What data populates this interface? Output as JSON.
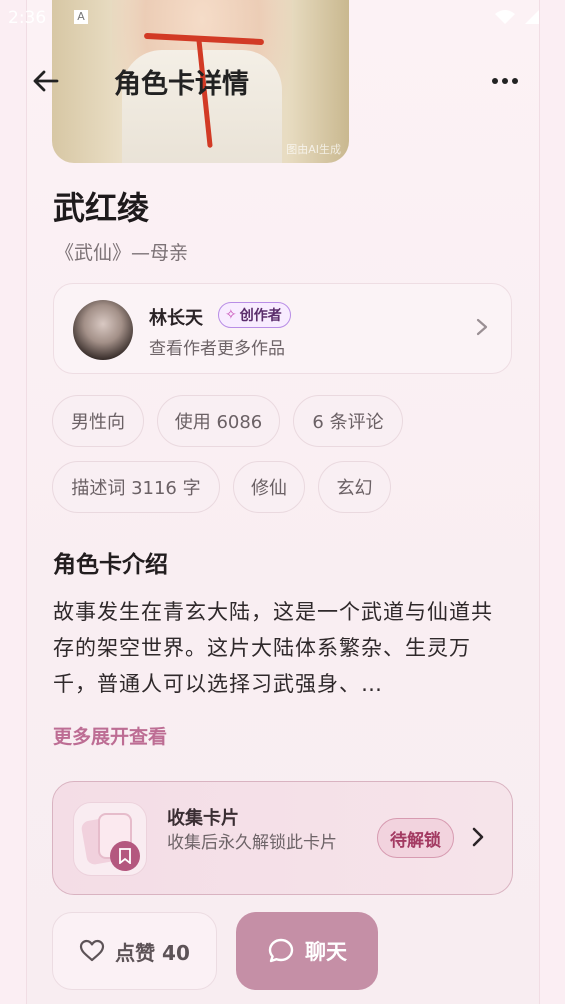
{
  "status_bar": {
    "time": "2:36",
    "notif_icon": "A"
  },
  "header": {
    "title": "角色卡详情",
    "back_icon": "arrow-left-icon",
    "more_icon": "more-dots-icon"
  },
  "hero": {
    "watermark": "图由AI生成"
  },
  "character": {
    "name": "武红绫",
    "subtitle": "《武仙》—母亲"
  },
  "author": {
    "name": "林长天",
    "badge": "创作者",
    "more_text": "查看作者更多作品"
  },
  "tags": [
    "男性向",
    "使用 6086",
    "6 条评论",
    "描述词 3116 字",
    "修仙",
    "玄幻"
  ],
  "intro": {
    "title": "角色卡介绍",
    "text": "故事发生在青玄大陆，这是一个武道与仙道共存的架空世界。这片大陆体系繁杂、生灵万千，普通人可以选择习武强身、…",
    "expand_label": "更多展开查看"
  },
  "collect": {
    "title": "收集卡片",
    "description": "收集后永久解锁此卡片",
    "status": "待解锁"
  },
  "actions": {
    "like_label": "点赞 40",
    "chat_label": "聊天"
  },
  "colors": {
    "accent": "#c58fa6",
    "link": "#bd6d94",
    "unlock": "#a33a62"
  }
}
